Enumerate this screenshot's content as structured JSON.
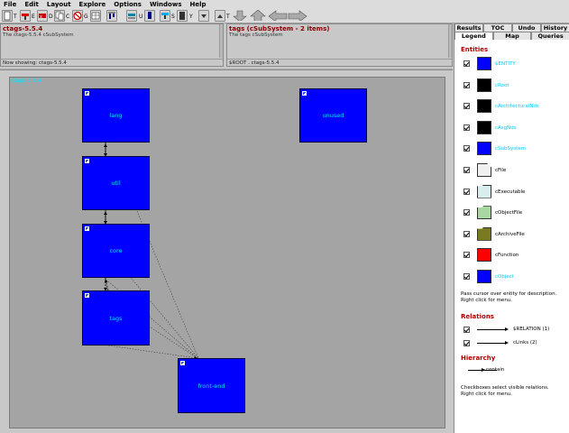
{
  "menu": [
    "File",
    "Edit",
    "Layout",
    "Explore",
    "Options",
    "Windows",
    "Help"
  ],
  "toolbar": {
    "letters": [
      "T",
      "E",
      "D",
      "C",
      "G",
      "U",
      "S",
      "Y",
      "T"
    ]
  },
  "left_panel": {
    "title": "ctags-5.5.4",
    "subtitle": "The ctags-5.5.4 cSubSystem",
    "footer": "Now showing: ctags-5.5.4"
  },
  "right_panel": {
    "title": "tags (cSubSystem - 2 items)",
    "subtitle": "The tags cSubSystem",
    "footer": "$ROOT . ctags-5.5.4"
  },
  "canvas": {
    "label": "ctags-5.5.4",
    "nodes": [
      {
        "id": "lang",
        "label": "lang"
      },
      {
        "id": "unused",
        "label": "unused"
      },
      {
        "id": "util",
        "label": "util"
      },
      {
        "id": "core",
        "label": "core"
      },
      {
        "id": "tags",
        "label": "tags"
      },
      {
        "id": "front-end",
        "label": "front-end"
      }
    ]
  },
  "sidebar": {
    "tabs_top": [
      "Results",
      "TOC",
      "Undo",
      "History"
    ],
    "tabs_bottom": [
      "Legend",
      "Map",
      "Queries"
    ],
    "entities_title": "Entities",
    "entities": [
      {
        "label": "$ENTITY",
        "color": "#0000ff",
        "label_color": "#00c8ff"
      },
      {
        "label": "cRoot",
        "color": "#000000",
        "label_color": "#00c8ff"
      },
      {
        "label": "cArchitecturalNds",
        "color": "#000000",
        "label_color": "#00c8ff"
      },
      {
        "label": "cAsgNds",
        "color": "#000000",
        "label_color": "#00c8ff"
      },
      {
        "label": "cSubSystem",
        "color": "#0000ff",
        "label_color": "#00c8ff"
      },
      {
        "label": "cFile",
        "color": "#f0f0f0",
        "label_color": "#000000"
      },
      {
        "label": "cExecutable",
        "color": "#d8eeee",
        "label_color": "#000000"
      },
      {
        "label": "cObjectFile",
        "color": "#a8d8a0",
        "label_color": "#000000"
      },
      {
        "label": "cArchiveFile",
        "color": "#7a7a20",
        "label_color": "#000000"
      },
      {
        "label": "cFunction",
        "color": "#ff0000",
        "label_color": "#000000"
      },
      {
        "label": "cObject",
        "color": "#0000ff",
        "label_color": "#00c8ff"
      }
    ],
    "entities_hint": [
      "Pass cursor over entity for description.",
      "Right click for menu."
    ],
    "relations_title": "Relations",
    "relations": [
      {
        "label": "$RELATION (1)"
      },
      {
        "label": "cLinks (2)"
      }
    ],
    "hierarchy_title": "Hierarchy",
    "hierarchy": {
      "label": "contain"
    },
    "relations_hint": [
      "Checkboxes select visible relations.",
      "Right click for menu."
    ]
  }
}
